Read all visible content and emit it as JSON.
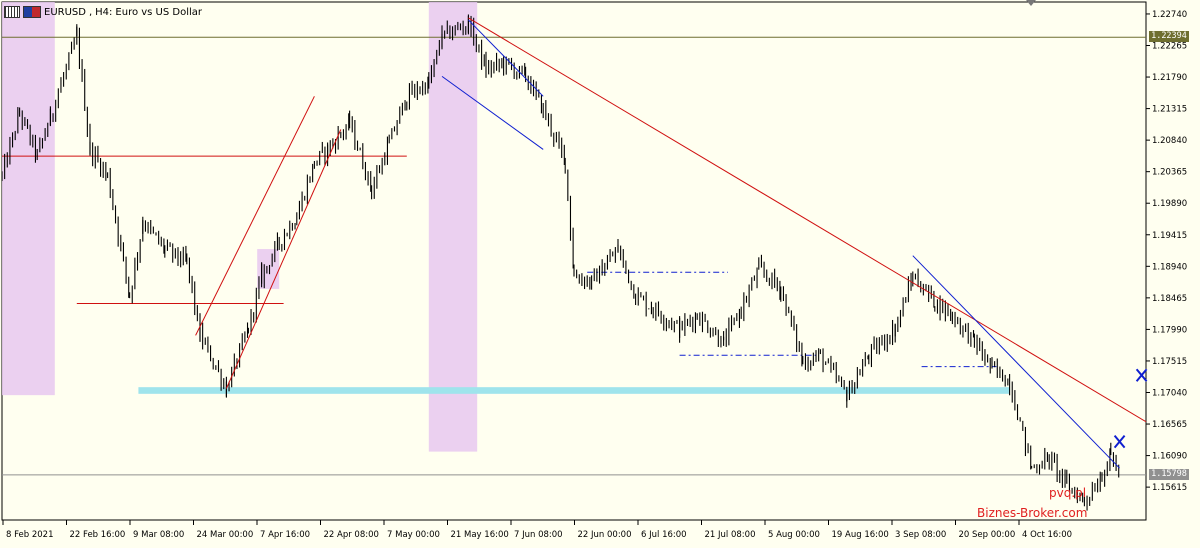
{
  "title": {
    "symbol": "EURUSD",
    "timeframe": "H4:",
    "description": "Euro vs US Dollar"
  },
  "watermarks": {
    "site": "pvq.pl",
    "broker": "Biznes-Broker.com"
  },
  "colors": {
    "background": "#fffff0",
    "candles": "#000000",
    "trend_red": "#d01010",
    "trend_blue": "#1020d0",
    "support_zone": "#9fe4ec",
    "highlight_zone": "#e8c8f0",
    "current_price_line": "#909090",
    "ref_price_line": "#6f6f30"
  },
  "icons": [
    "chart-symbol-icon",
    "us-eu-flag-icon",
    "cross-marker-icon",
    "dropdown-marker-icon"
  ],
  "chart_data": {
    "type": "candlestick",
    "symbol": "EURUSD",
    "timeframe": "H4",
    "price_axis": {
      "ylim": [
        1.1512,
        1.2292
      ],
      "ticks": [
        "1.22740",
        "1.22265",
        "1.21790",
        "1.21315",
        "1.20840",
        "1.20365",
        "1.19890",
        "1.19415",
        "1.18940",
        "1.18465",
        "1.17990",
        "1.17515",
        "1.17040",
        "1.16565",
        "1.16090",
        "1.15615"
      ],
      "current_price": "1.15798",
      "reference_price": "1.22394"
    },
    "time_axis": {
      "labels": [
        "8 Feb 2021",
        "22 Feb 16:00",
        "9 Mar 08:00",
        "24 Mar 00:00",
        "7 Apr 16:00",
        "22 Apr 08:00",
        "7 May 00:00",
        "21 May 16:00",
        "7 Jun 08:00",
        "22 Jun 00:00",
        "6 Jul 16:00",
        "21 Jul 08:00",
        "5 Aug 00:00",
        "19 Aug 16:00",
        "3 Sep 08:00",
        "20 Sep 00:00",
        "4 Oct 16:00"
      ],
      "x_start": "2021-02-08",
      "x_end": "2021-10-26"
    },
    "series": [
      {
        "name": "EURUSD",
        "points": [
          [
            "2021-02-08",
            1.203
          ],
          [
            "2021-02-12",
            1.2125
          ],
          [
            "2021-02-16",
            1.206
          ],
          [
            "2021-02-19",
            1.212
          ],
          [
            "2021-02-25",
            1.224
          ],
          [
            "2021-02-28",
            1.207
          ],
          [
            "2021-03-04",
            1.203
          ],
          [
            "2021-03-09",
            1.185
          ],
          [
            "2021-03-12",
            1.196
          ],
          [
            "2021-03-17",
            1.192
          ],
          [
            "2021-03-22",
            1.19
          ],
          [
            "2021-03-25",
            1.179
          ],
          [
            "2021-03-31",
            1.171
          ],
          [
            "2021-04-05",
            1.18
          ],
          [
            "2021-04-08",
            1.188
          ],
          [
            "2021-04-12",
            1.193
          ],
          [
            "2021-04-16",
            1.197
          ],
          [
            "2021-04-20",
            1.205
          ],
          [
            "2021-04-23",
            1.207
          ],
          [
            "2021-04-28",
            1.211
          ],
          [
            "2021-05-03",
            1.201
          ],
          [
            "2021-05-07",
            1.208
          ],
          [
            "2021-05-11",
            1.215
          ],
          [
            "2021-05-16",
            1.217
          ],
          [
            "2021-05-19",
            1.224
          ],
          [
            "2021-05-25",
            1.226
          ],
          [
            "2021-05-29",
            1.219
          ],
          [
            "2021-06-02",
            1.22
          ],
          [
            "2021-06-07",
            1.218
          ],
          [
            "2021-06-11",
            1.213
          ],
          [
            "2021-06-16",
            1.205
          ],
          [
            "2021-06-18",
            1.188
          ],
          [
            "2021-06-22",
            1.187
          ],
          [
            "2021-06-28",
            1.192
          ],
          [
            "2021-07-02",
            1.185
          ],
          [
            "2021-07-06",
            1.183
          ],
          [
            "2021-07-12",
            1.18
          ],
          [
            "2021-07-16",
            1.182
          ],
          [
            "2021-07-22",
            1.178
          ],
          [
            "2021-07-26",
            1.183
          ],
          [
            "2021-07-30",
            1.189
          ],
          [
            "2021-08-04",
            1.186
          ],
          [
            "2021-08-09",
            1.175
          ],
          [
            "2021-08-13",
            1.176
          ],
          [
            "2021-08-19",
            1.17
          ],
          [
            "2021-08-24",
            1.176
          ],
          [
            "2021-08-30",
            1.18
          ],
          [
            "2021-09-03",
            1.188
          ],
          [
            "2021-09-08",
            1.184
          ],
          [
            "2021-09-12",
            1.182
          ],
          [
            "2021-09-17",
            1.178
          ],
          [
            "2021-09-21",
            1.174
          ],
          [
            "2021-09-25",
            1.172
          ],
          [
            "2021-09-30",
            1.159
          ],
          [
            "2021-10-04",
            1.1605
          ],
          [
            "2021-10-08",
            1.1565
          ],
          [
            "2021-10-12",
            1.154
          ],
          [
            "2021-10-16",
            1.158
          ],
          [
            "2021-10-18",
            1.161
          ],
          [
            "2021-10-20",
            1.158
          ]
        ]
      }
    ],
    "annotations": {
      "horizontal_lines": [
        {
          "price": 1.206,
          "from": "2021-02-08",
          "to": "2021-05-11",
          "color": "#d01010"
        },
        {
          "price": 1.1838,
          "from": "2021-02-25",
          "to": "2021-04-13",
          "color": "#d01010"
        },
        {
          "price": 1.2239,
          "from": "2021-02-08",
          "to": "2021-10-26",
          "color": "#6f6f30"
        },
        {
          "price": 1.158,
          "from": "2021-02-08",
          "to": "2021-10-26",
          "color": "#909090"
        }
      ],
      "dash_lines": [
        {
          "price": 1.1885,
          "from": "2021-06-21",
          "to": "2021-07-23",
          "color": "#1020d0"
        },
        {
          "price": 1.176,
          "from": "2021-07-12",
          "to": "2021-08-12",
          "color": "#1020d0"
        },
        {
          "price": 1.1743,
          "from": "2021-09-05",
          "to": "2021-09-22",
          "color": "#1020d0"
        }
      ],
      "trend_lines": [
        {
          "from": [
            "2021-05-25",
            1.2268
          ],
          "to": [
            "2021-10-26",
            1.166
          ],
          "color": "#d01010"
        },
        {
          "from": [
            "2021-03-24",
            1.179
          ],
          "to": [
            "2021-04-20",
            1.215
          ],
          "color": "#d01010"
        },
        {
          "from": [
            "2021-03-31",
            1.171
          ],
          "to": [
            "2021-04-26",
            1.21
          ],
          "color": "#d01010"
        },
        {
          "from": [
            "2021-05-25",
            1.2265
          ],
          "to": [
            "2021-06-11",
            1.215
          ],
          "color": "#1020d0"
        },
        {
          "from": [
            "2021-05-19",
            1.218
          ],
          "to": [
            "2021-06-11",
            1.207
          ],
          "color": "#1020d0"
        },
        {
          "from": [
            "2021-09-03",
            1.191
          ],
          "to": [
            "2021-10-20",
            1.159
          ],
          "color": "#1020d0"
        }
      ],
      "zones": [
        {
          "kind": "highlight",
          "from": "2021-02-08",
          "to": "2021-02-20",
          "price_top": 1.2292,
          "price_bottom": 1.17
        },
        {
          "kind": "highlight",
          "from": "2021-05-16",
          "to": "2021-05-27",
          "price_top": 1.2292,
          "price_bottom": 1.1615
        },
        {
          "kind": "highlight",
          "from": "2021-04-07",
          "to": "2021-04-12",
          "price_top": 1.192,
          "price_bottom": 1.186
        },
        {
          "kind": "support",
          "from": "2021-03-11",
          "to": "2021-09-25",
          "price_top": 1.1712,
          "price_bottom": 1.1702
        }
      ],
      "markers": [
        {
          "symbol": "cross",
          "date": "2021-10-20",
          "price": 1.163
        },
        {
          "symbol": "cross",
          "date": "2021-10-25",
          "price": 1.173
        }
      ]
    }
  }
}
